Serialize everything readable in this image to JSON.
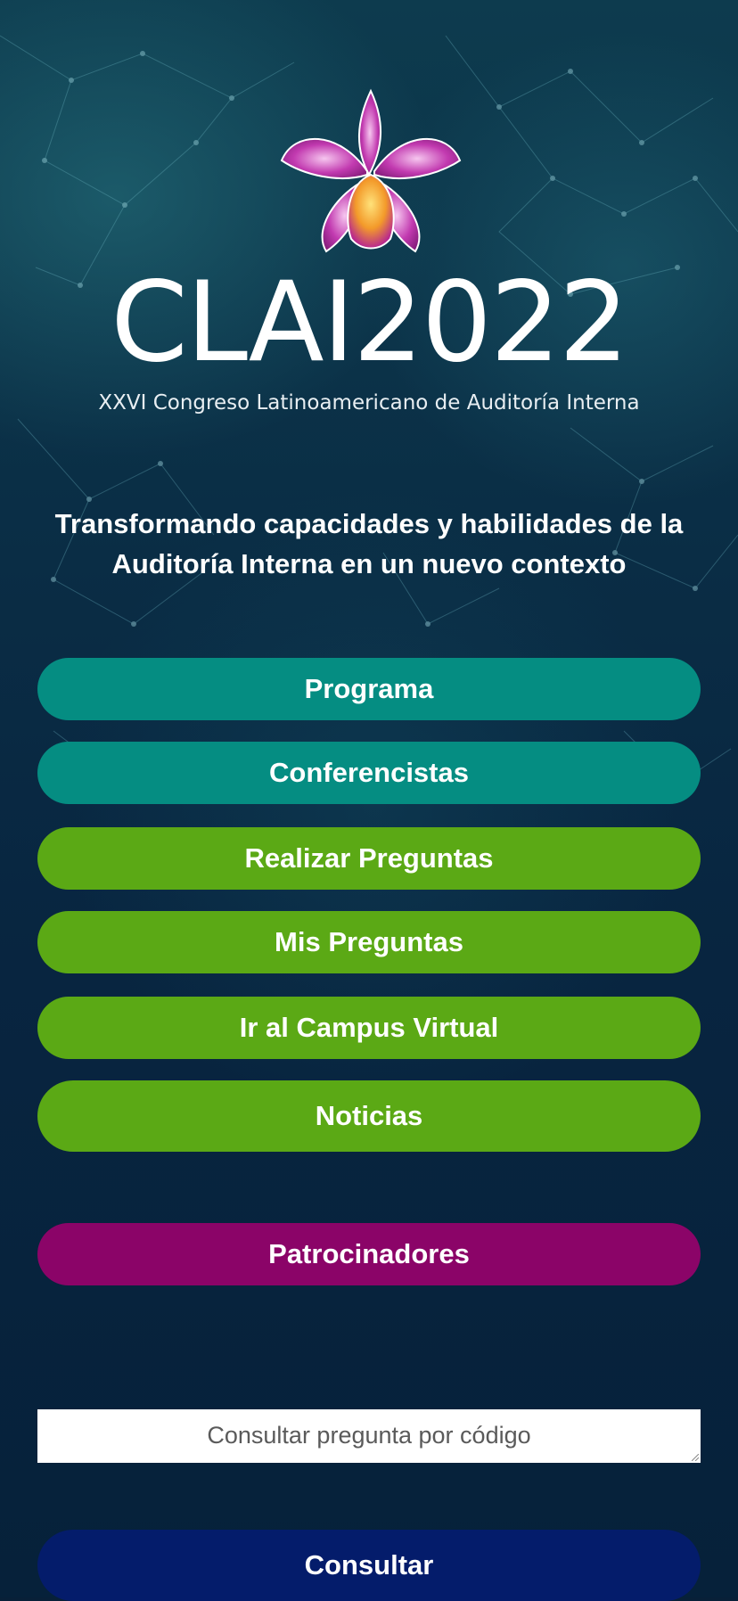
{
  "header": {
    "logo_title": "CLAI2022",
    "logo_subtitle": "XXVI Congreso Latinoamericano de Auditoría Interna",
    "logo_icon": "orchid-icon"
  },
  "tagline": "Transformando capacidades y habilidades de la Auditoría Interna en un nuevo contexto",
  "menu": {
    "programa": "Programa",
    "conferencistas": "Conferencistas",
    "realizar_preguntas": "Realizar Preguntas",
    "mis_preguntas": "Mis Preguntas",
    "campus_virtual": "Ir al Campus Virtual",
    "noticias": "Noticias",
    "patrocinadores": "Patrocinadores"
  },
  "query": {
    "placeholder": "Consultar pregunta por código",
    "value": "",
    "submit_label": "Consultar"
  },
  "colors": {
    "teal": "#058d82",
    "green": "#5ba915",
    "magenta": "#8b0468",
    "navy": "#041c6b",
    "background": "#082038"
  }
}
